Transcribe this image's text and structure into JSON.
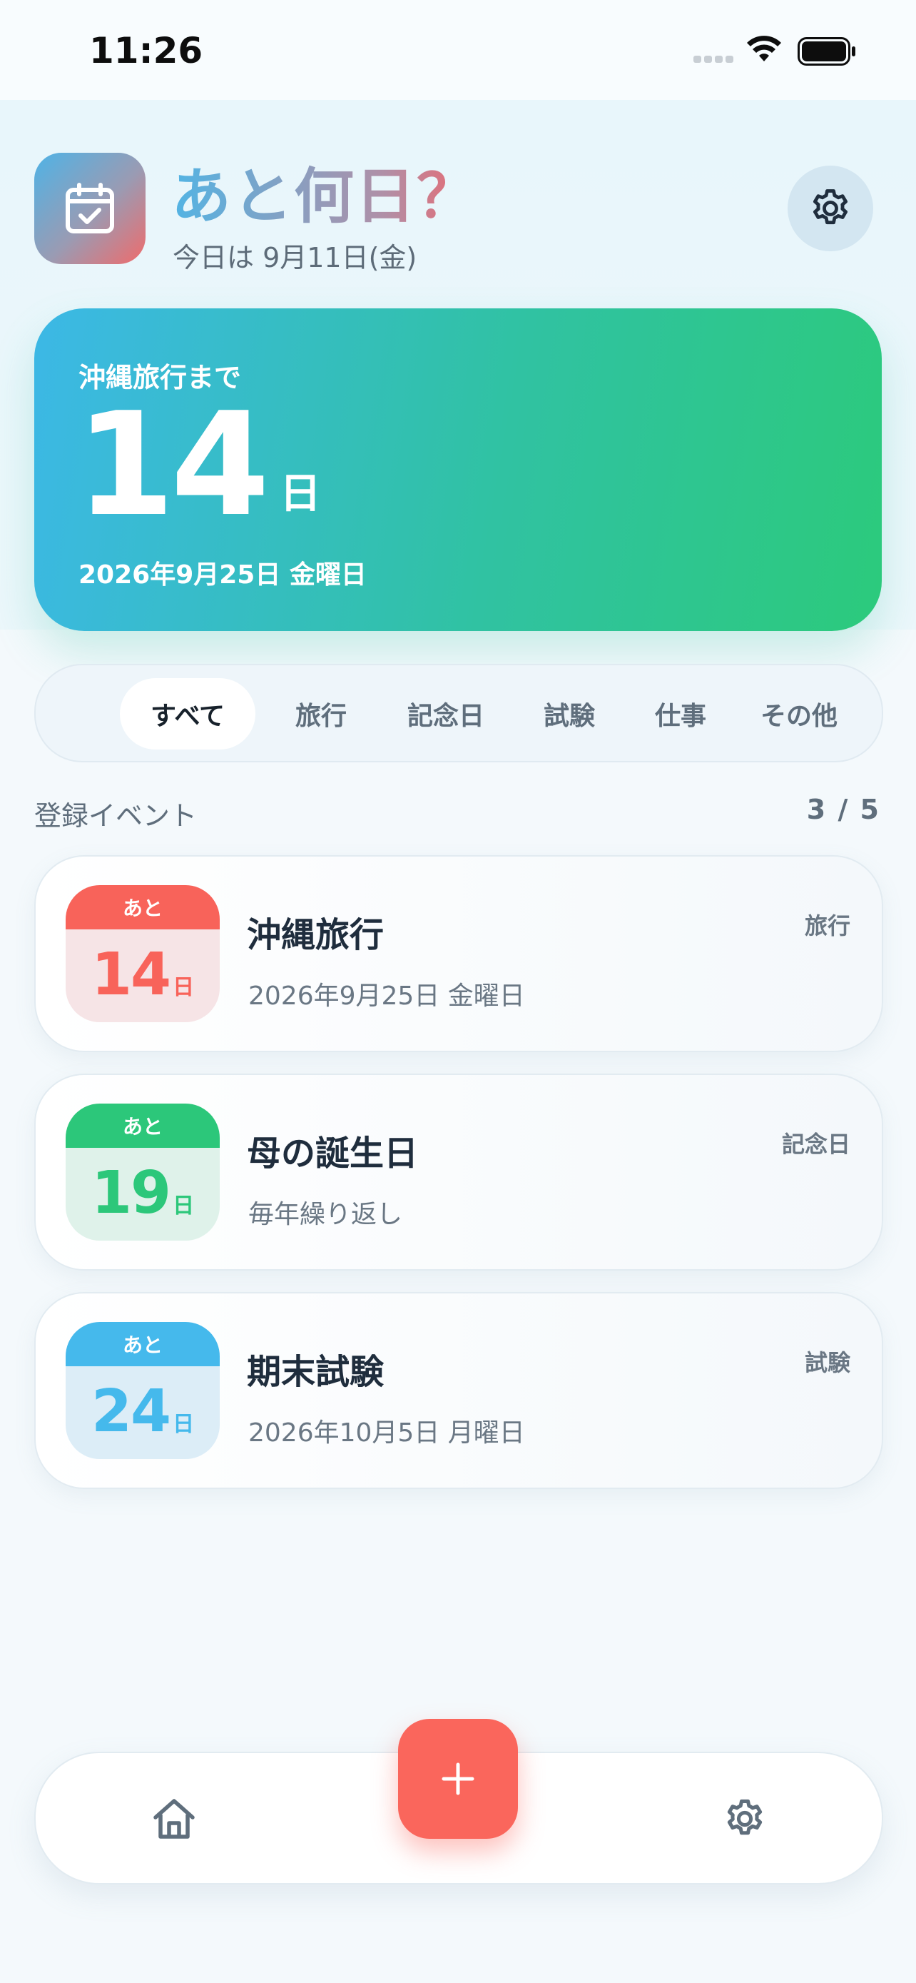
{
  "status_bar": {
    "time": "11:26"
  },
  "header": {
    "title": "あと何日？",
    "today": "今日は 9月11日(金)",
    "app_icon": "calendar-check-icon",
    "settings_icon": "gear-icon"
  },
  "hero": {
    "label": "沖縄旅行まで",
    "days": "14",
    "unit": "日",
    "date": "2026年9月25日 金曜日"
  },
  "tabs": [
    {
      "label": "すべて",
      "active": true
    },
    {
      "label": "旅行",
      "active": false
    },
    {
      "label": "記念日",
      "active": false
    },
    {
      "label": "試験",
      "active": false
    },
    {
      "label": "仕事",
      "active": false
    },
    {
      "label": "その他",
      "active": false
    }
  ],
  "list": {
    "title": "登録イベント",
    "count": "3 / 5"
  },
  "events": [
    {
      "prefix": "あと",
      "days": "14",
      "unit": "日",
      "name": "沖縄旅行",
      "sub": "2026年9月25日 金曜日",
      "tag": "旅行",
      "color": "#f8635a",
      "tint": "#f6e4e6"
    },
    {
      "prefix": "あと",
      "days": "19",
      "unit": "日",
      "name": "母の誕生日",
      "sub": "毎年繰り返し",
      "tag": "記念日",
      "color": "#2cc77a",
      "tint": "#dff2ea"
    },
    {
      "prefix": "あと",
      "days": "24",
      "unit": "日",
      "name": "期末試験",
      "sub": "2026年10月5日 月曜日",
      "tag": "試験",
      "color": "#45b9ec",
      "tint": "#dcedf7"
    }
  ],
  "bottom_nav": {
    "home_icon": "home-icon",
    "add_icon": "plus-icon",
    "settings_icon": "gear-icon"
  },
  "colors": {
    "accent": "#fa665c",
    "hero_start": "#3cb8e6",
    "hero_end": "#2cca7c",
    "text_dark": "#1f2d3d",
    "text_muted": "#5f6e7c"
  }
}
